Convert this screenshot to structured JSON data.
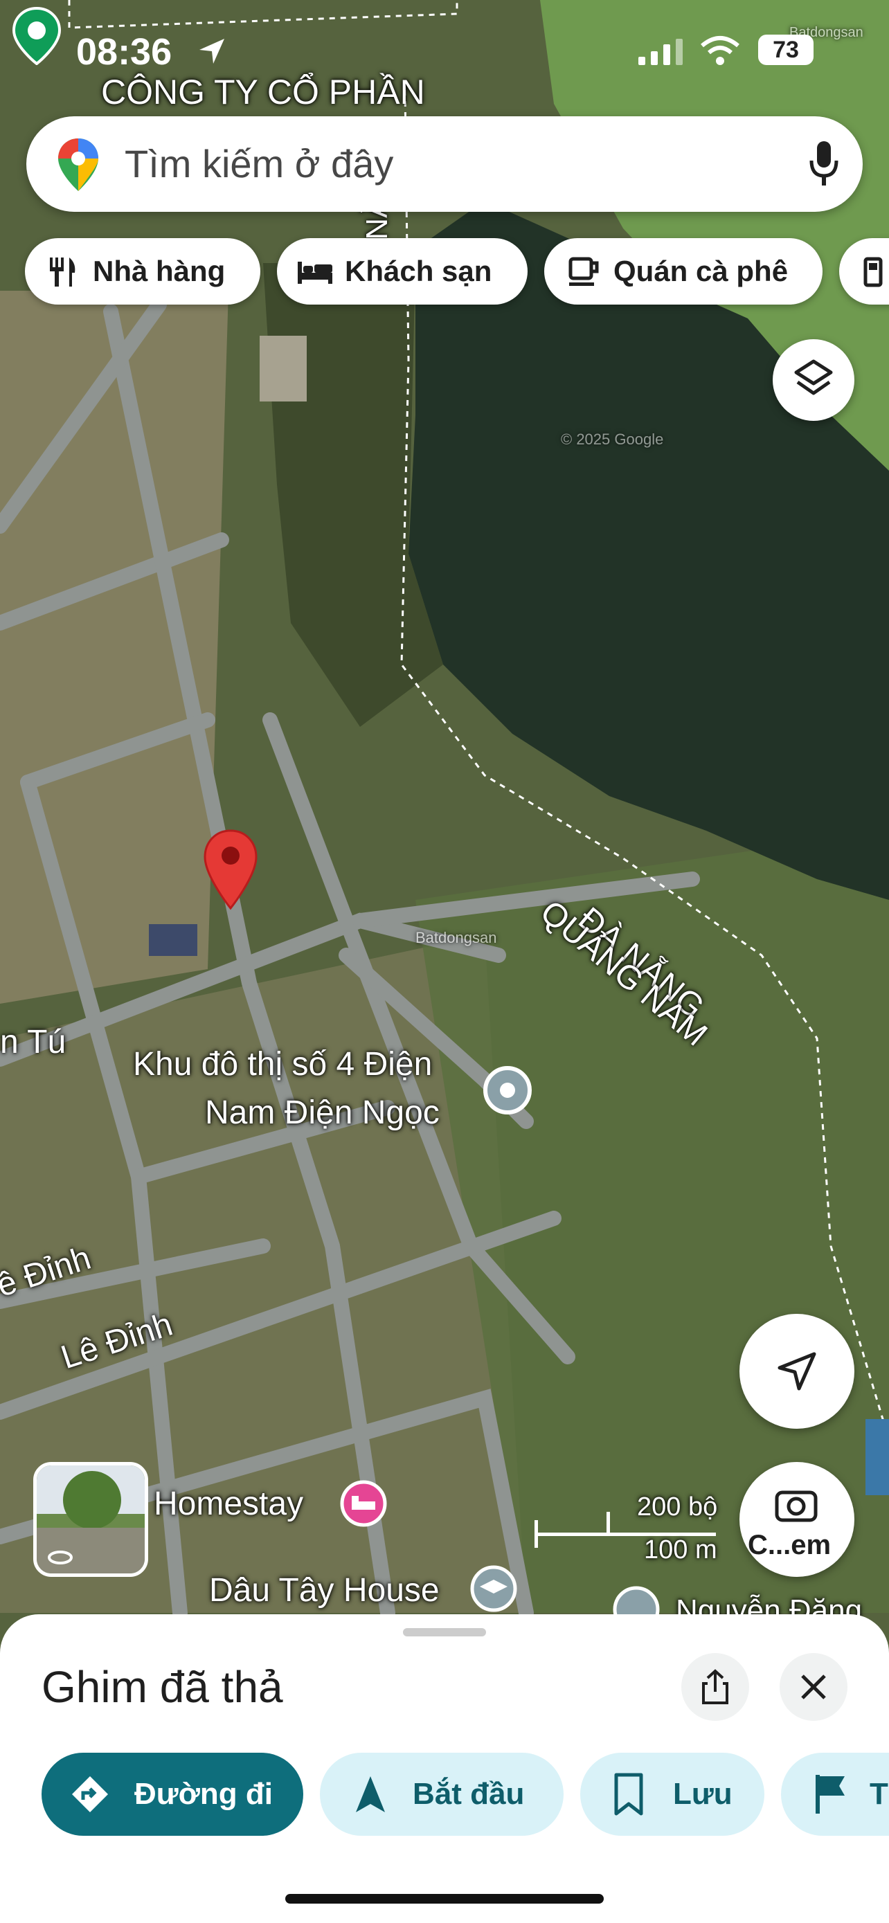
{
  "status_bar": {
    "time": "08:36",
    "battery": "73"
  },
  "search": {
    "placeholder": "Tìm kiếm ở đây"
  },
  "chips": [
    {
      "label": "Nhà hàng",
      "icon": "fork-knife-icon"
    },
    {
      "label": "Khách sạn",
      "icon": "bed-icon"
    },
    {
      "label": "Quán cà phê",
      "icon": "coffee-cup-icon"
    },
    {
      "label": "",
      "icon": "gas-station-icon"
    }
  ],
  "map_labels": {
    "company": "CÔNG TY CỔ PHẦN",
    "province_da_nang": "ĐÀ NẴNG",
    "province_da_nang_2": "ĐÀ NẴNG",
    "province_quang_nam": "QUẢNG NAM",
    "khu_do_thi_line1": "Khu đô thị số 4 Điện",
    "khu_do_thi_line2": "Nam Điện Ngọc",
    "street_tu": "n Tú",
    "street_le_dinh": "Lê Đỉnh",
    "street_le_dinh_partial": "ê Đỉnh",
    "homestay": "Homestay",
    "dau_tay_house": "Dâu Tây House",
    "nguyen_dang": "Nguyễn Đăng",
    "copyright": "© 2025 Google",
    "watermark": "Batdongsan"
  },
  "scale": {
    "imperial": "200 bộ",
    "metric": "100 m"
  },
  "camera_button": {
    "label": "C...em"
  },
  "sheet": {
    "title": "Ghim đã thả",
    "actions": [
      {
        "label": "Đường đi",
        "icon": "directions-icon"
      },
      {
        "label": "Bắt đầu",
        "icon": "navigation-arrow-icon"
      },
      {
        "label": "Lưu",
        "icon": "bookmark-icon"
      },
      {
        "label": "T",
        "icon": "flag-icon"
      }
    ]
  },
  "colors": {
    "accent": "#0e6e7c",
    "pin": "#e53935"
  }
}
